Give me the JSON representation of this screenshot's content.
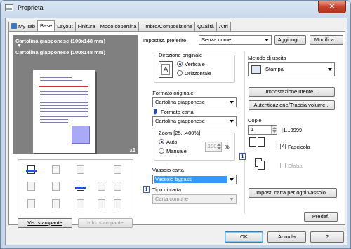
{
  "window": {
    "title": "Proprietà",
    "close": "✕"
  },
  "tabs": [
    {
      "label": "My Tab"
    },
    {
      "label": "Base"
    },
    {
      "label": "Layout"
    },
    {
      "label": "Finitura"
    },
    {
      "label": "Modo copertina"
    },
    {
      "label": "Timbro/Composizione"
    },
    {
      "label": "Qualità"
    },
    {
      "label": "Altri"
    }
  ],
  "preview": {
    "line1": "Cartolina giapponese (100x148 mm)",
    "line2": "Cartolina giapponese (100x148 mm)",
    "copies_badge": "x1"
  },
  "left_buttons": {
    "printer_view": "Vis. stampante",
    "printer_info": "Info. stampante"
  },
  "favorites": {
    "label": "Impostaz. preferite",
    "value": "Senza nome",
    "add": "Aggiungi...",
    "edit": "Modifica..."
  },
  "orientation": {
    "title": "Direzione originale",
    "portrait": "Verticale",
    "landscape": "Orizzontale"
  },
  "original_size": {
    "label": "Formato originale",
    "value": "Cartolina giapponese"
  },
  "paper_size": {
    "label": "Formato carta",
    "value": "Cartolina giapponese"
  },
  "zoom": {
    "title": "Zoom [25...400%]",
    "auto": "Auto",
    "manual": "Manuale",
    "value": "100",
    "unit": "%"
  },
  "paper_tray": {
    "label": "Vassoio carta",
    "value": "Vassoio bypass"
  },
  "paper_type": {
    "label": "Tipo di carta",
    "value": "Carta comune"
  },
  "output": {
    "label": "Metodo di uscita",
    "value": "Stampa"
  },
  "user_settings": "Impostazione utente...",
  "auth": "Autenticazione/Traccia volume...",
  "copies": {
    "label": "Copie",
    "value": "1",
    "range": "[1...9999]"
  },
  "collate": "Fascicola",
  "offset": "Sfalsa",
  "paper_per_tray": "Impost. carta per ogni vassoio...",
  "defaults": "Predef.",
  "footer": {
    "ok": "OK",
    "cancel": "Annulla",
    "help": "?"
  },
  "colors": {
    "accent": "#3399ff",
    "preview_bg": "#808080"
  },
  "icons": {
    "title": "printer-properties-icon",
    "orientation": "portrait-page-icon",
    "output": "printer-output-icon",
    "collate": "collate-icon",
    "offset": "offset-icon",
    "info": "info-icon",
    "arrow": "down-arrow-icon"
  }
}
